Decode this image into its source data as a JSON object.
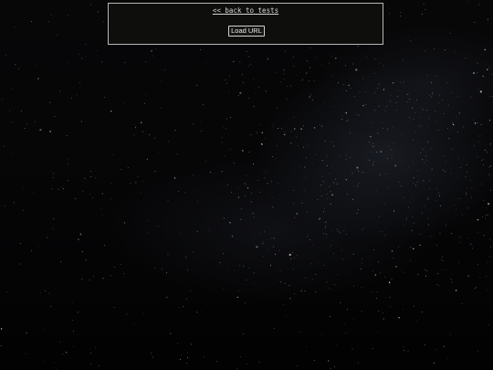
{
  "panel": {
    "back_link_label": "<< back to tests",
    "load_button_label": "Load URL"
  },
  "colors": {
    "panel_border": "#b8b8b8",
    "panel_background": "#0e0e0c",
    "link_text": "#d6d6d6",
    "page_background": "#030303"
  }
}
